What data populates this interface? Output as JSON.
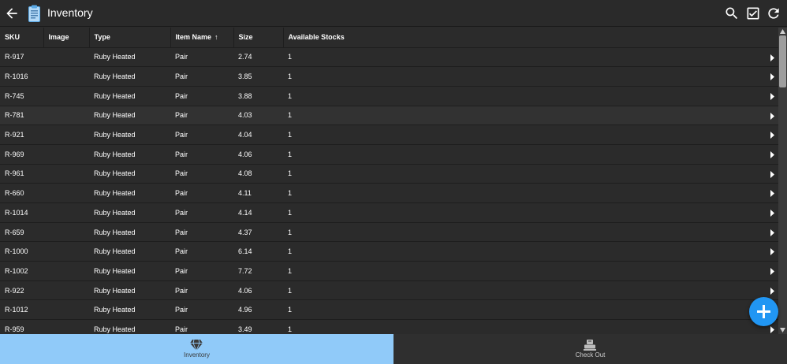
{
  "header": {
    "title": "Inventory",
    "back_icon": "arrow-left-icon",
    "app_icon": "clipboard-icon",
    "actions": [
      "search-icon",
      "checkbox-icon",
      "refresh-icon"
    ]
  },
  "table": {
    "columns": [
      "SKU",
      "Image",
      "Type",
      "Item Name",
      "Size",
      "Available Stocks"
    ],
    "sort_column": "Item Name",
    "sort_direction": "ascending",
    "rows": [
      {
        "sku": "R-917",
        "type": "Ruby Heated",
        "item_name": "Pair",
        "size": "2.74",
        "stock": "1"
      },
      {
        "sku": "R-1016",
        "type": "Ruby Heated",
        "item_name": "Pair",
        "size": "3.85",
        "stock": "1"
      },
      {
        "sku": "R-745",
        "type": "Ruby Heated",
        "item_name": "Pair",
        "size": "3.88",
        "stock": "1"
      },
      {
        "sku": "R-781",
        "type": "Ruby Heated",
        "item_name": "Pair",
        "size": "4.03",
        "stock": "1"
      },
      {
        "sku": "R-921",
        "type": "Ruby Heated",
        "item_name": "Pair",
        "size": "4.04",
        "stock": "1"
      },
      {
        "sku": "R-969",
        "type": "Ruby Heated",
        "item_name": "Pair",
        "size": "4.06",
        "stock": "1"
      },
      {
        "sku": "R-961",
        "type": "Ruby Heated",
        "item_name": "Pair",
        "size": "4.08",
        "stock": "1"
      },
      {
        "sku": "R-660",
        "type": "Ruby Heated",
        "item_name": "Pair",
        "size": "4.11",
        "stock": "1"
      },
      {
        "sku": "R-1014",
        "type": "Ruby Heated",
        "item_name": "Pair",
        "size": "4.14",
        "stock": "1"
      },
      {
        "sku": "R-659",
        "type": "Ruby Heated",
        "item_name": "Pair",
        "size": "4.37",
        "stock": "1"
      },
      {
        "sku": "R-1000",
        "type": "Ruby Heated",
        "item_name": "Pair",
        "size": "6.14",
        "stock": "1"
      },
      {
        "sku": "R-1002",
        "type": "Ruby Heated",
        "item_name": "Pair",
        "size": "7.72",
        "stock": "1"
      },
      {
        "sku": "R-922",
        "type": "Ruby Heated",
        "item_name": "Pair",
        "size": "4.06",
        "stock": "1"
      },
      {
        "sku": "R-1012",
        "type": "Ruby Heated",
        "item_name": "Pair",
        "size": "4.96",
        "stock": "1"
      },
      {
        "sku": "R-959",
        "type": "Ruby Heated",
        "item_name": "Pair",
        "size": "3.49",
        "stock": "1"
      }
    ],
    "highlighted_row": 3
  },
  "fab": {
    "icon": "plus-icon"
  },
  "bottom_nav": {
    "tabs": [
      {
        "label": "Inventory",
        "icon": "diamond-icon",
        "active": true
      },
      {
        "label": "Check Out",
        "icon": "checkout-icon",
        "active": false
      }
    ]
  },
  "colors": {
    "background": "#2b2b2b",
    "topbar": "#2a2a2a",
    "active_tab": "#90caf9",
    "inactive_tab": "#2f2f2f",
    "fab": "#2196f3",
    "text": "#ffffff"
  }
}
